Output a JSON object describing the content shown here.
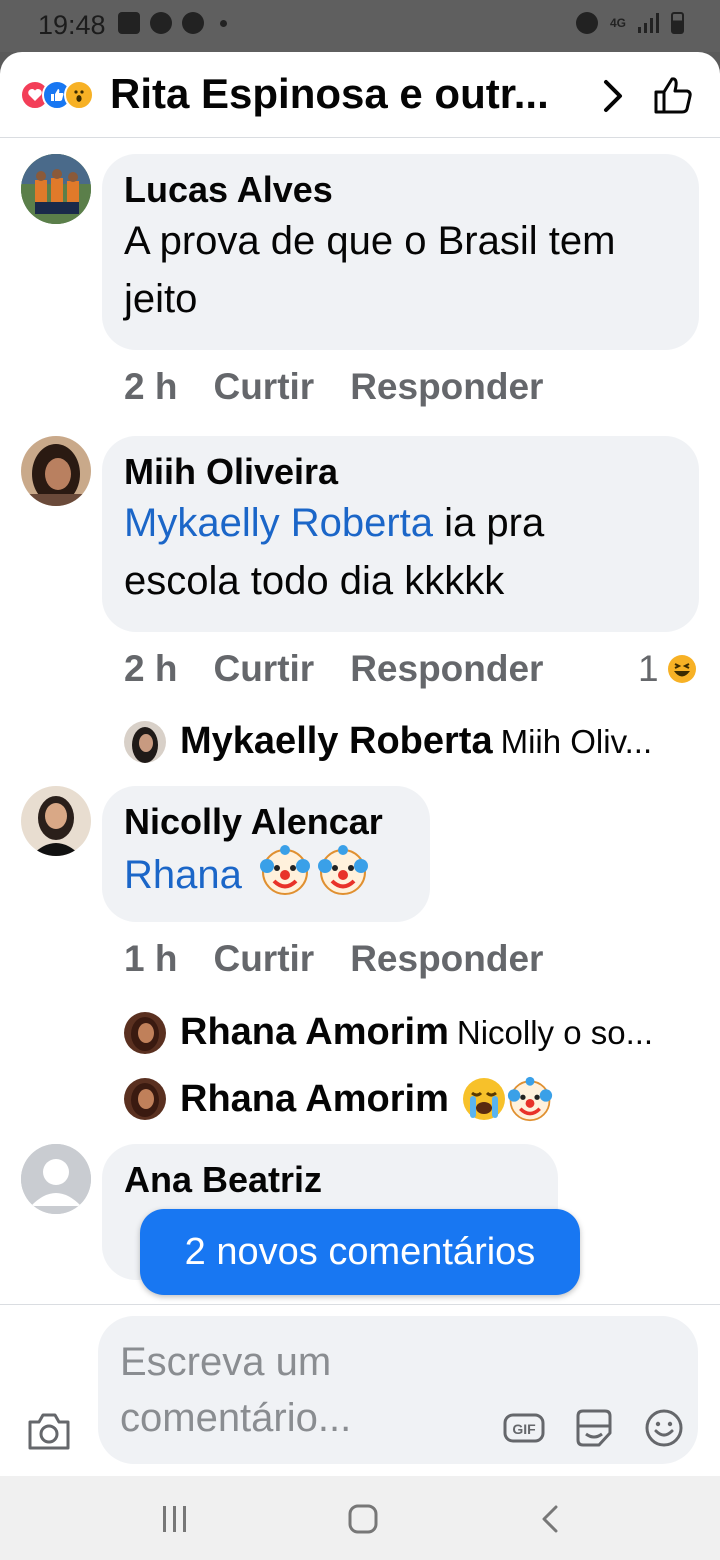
{
  "status_bar": {
    "time": "19:48",
    "network": "4G"
  },
  "header": {
    "title": "Rita Espinosa e outr..."
  },
  "comments": [
    {
      "author": "Lucas Alves",
      "text": "A prova de que o Brasil tem jeito",
      "time": "2 h",
      "like_label": "Curtir",
      "reply_label": "Responder"
    },
    {
      "author": "Miih Oliveira",
      "mention": "Mykaelly Roberta",
      "text": "ia pra escola todo dia kkkkk",
      "time": "2 h",
      "like_label": "Curtir",
      "reply_label": "Responder",
      "reaction_count": "1",
      "replies": [
        {
          "name": "Mykaelly Roberta",
          "snippet": "Miih Oliv..."
        }
      ]
    },
    {
      "author": "Nicolly Alencar",
      "mention": "Rhana",
      "time": "1 h",
      "like_label": "Curtir",
      "reply_label": "Responder",
      "replies": [
        {
          "name": "Rhana Amorim",
          "snippet": "Nicolly o so..."
        },
        {
          "name": "Rhana Amorim",
          "snippet": ""
        }
      ]
    },
    {
      "author": "Ana Beatriz"
    }
  ],
  "new_comments_pill": "2 novos comentários",
  "composer": {
    "placeholder": "Escreva um comentário...",
    "gif_label": "GIF"
  },
  "colors": {
    "facebook_blue": "#1877f2",
    "bubble_bg": "#f0f2f5",
    "meta_gray": "#65676b"
  }
}
